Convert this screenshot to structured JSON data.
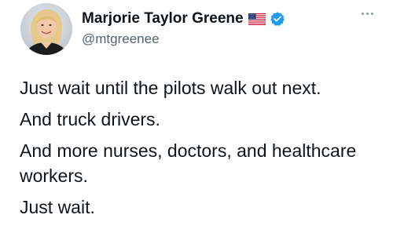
{
  "tweet": {
    "author": {
      "display_name": "Marjorie Taylor Greene",
      "handle": "@mtgreenee",
      "flag_icon": "us-flag-icon",
      "verified_icon": "verified-badge-icon",
      "verified_color": "#1d9bf0"
    },
    "more_icon": "more-options-icon",
    "paragraphs": [
      "Just wait until the pilots walk out next.",
      "And truck drivers.",
      "And more nurses, doctors, and healthcare workers.",
      "Just wait."
    ]
  }
}
